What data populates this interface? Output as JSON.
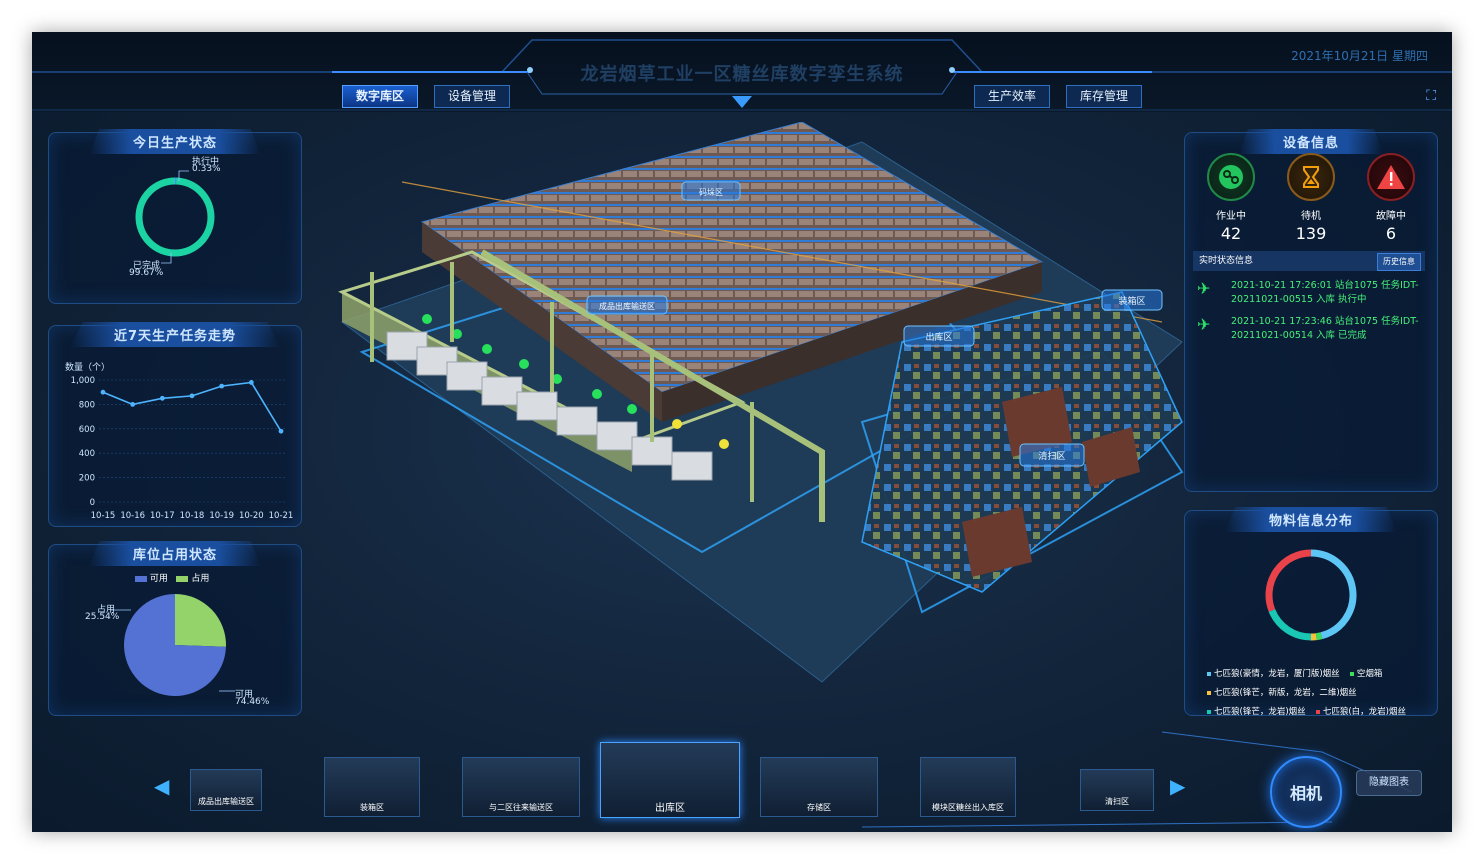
{
  "header": {
    "title": "龙岩烟草工业一区糖丝库数字孪生系统",
    "datetime": "2021年10月21日 星期四",
    "nav": [
      "数字库区",
      "设备管理",
      "生产效率",
      "库存管理"
    ],
    "active_nav": "数字库区"
  },
  "today_status": {
    "title": "今日生产状态",
    "running_label": "执行中",
    "running_pct": "0.33%",
    "done_label": "已完成",
    "done_pct": "99.67%",
    "colors": {
      "done": "#1bd3a3",
      "running": "#4a8cff"
    }
  },
  "trend": {
    "title": "近7天生产任务走势",
    "ylabel": "数量（个）",
    "chart_data": {
      "type": "line",
      "categories": [
        "10-15",
        "10-16",
        "10-17",
        "10-18",
        "10-19",
        "10-20",
        "10-21"
      ],
      "values": [
        900,
        800,
        850,
        870,
        950,
        980,
        580
      ],
      "ylim": [
        0,
        1000
      ],
      "yticks": [
        "0",
        "200",
        "400",
        "600",
        "800",
        "1,000"
      ],
      "color": "#4fb4ff",
      "grid": true
    }
  },
  "storage": {
    "title": "库位占用状态",
    "legend_available": "可用",
    "legend_occupied": "占用",
    "occupied_label": "占用",
    "occupied_pct": "25.54%",
    "available_label": "可用",
    "available_pct": "74.46%",
    "chart_data": {
      "type": "pie",
      "labels": [
        "占用",
        "可用"
      ],
      "values": [
        25.54,
        74.46
      ],
      "colors": [
        "#93d36a",
        "#5472d3"
      ]
    }
  },
  "scene": {
    "zones": [
      "成品出库输送区",
      "码垛区",
      "装箱区",
      "出库区",
      "清扫区"
    ]
  },
  "devices": {
    "title": "设备信息",
    "items": [
      {
        "label": "作业中",
        "value": "42",
        "icon": "gear-running-icon",
        "color": "#22c55e"
      },
      {
        "label": "待机",
        "value": "139",
        "icon": "hourglass-icon",
        "color": "#f59e0b"
      },
      {
        "label": "故障中",
        "value": "6",
        "icon": "warning-icon",
        "color": "#ef4444"
      }
    ],
    "status_title": "实时状态信息",
    "history_label": "历史信息",
    "logs": [
      {
        "icon": "paper-plane-icon",
        "text": "2021-10-21 17:26:01 站台1075 任务IDT-20211021-00515 入库 执行中"
      },
      {
        "icon": "paper-plane-icon",
        "text": "2021-10-21 17:23:46 站台1075 任务IDT-20211021-00514 入库 已完成"
      }
    ]
  },
  "materials": {
    "title": "物料信息分布",
    "chart_data": {
      "type": "pie",
      "labels": [
        "七匹狼(豪情，龙岩，厦门版)烟丝",
        "空烟箱",
        "七匹狼(锋芒，新版，龙岩，二维)烟丝",
        "七匹狼(锋芒，龙岩)烟丝",
        "七匹狼(白，龙岩)烟丝"
      ],
      "values": [
        46,
        2,
        2,
        19,
        31
      ],
      "colors": [
        "#5ec6f5",
        "#3ddc5c",
        "#f5c33b",
        "#19c7b4",
        "#e8434b"
      ]
    },
    "legend": [
      {
        "text": "七匹狼(豪情，龙岩，厦门版)烟丝",
        "color": "#5ec6f5"
      },
      {
        "text": "空烟箱",
        "color": "#3ddc5c"
      },
      {
        "text": "七匹狼(锋芒，新版，龙岩，二维)烟丝",
        "color": "#f5c33b"
      },
      {
        "text": "七匹狼(锋芒，龙岩)烟丝",
        "color": "#19c7b4"
      },
      {
        "text": "七匹狼(白，龙岩)烟丝",
        "color": "#e8434b"
      }
    ]
  },
  "thumbnails": {
    "items": [
      "成品出库输送区",
      "装箱区",
      "与二区往来输送区",
      "出库区",
      "存储区",
      "模块区糖丝出入库区",
      "清扫区"
    ],
    "active": "出库区"
  },
  "camera_label": "相机",
  "hide_chart_label": "隐藏图表"
}
